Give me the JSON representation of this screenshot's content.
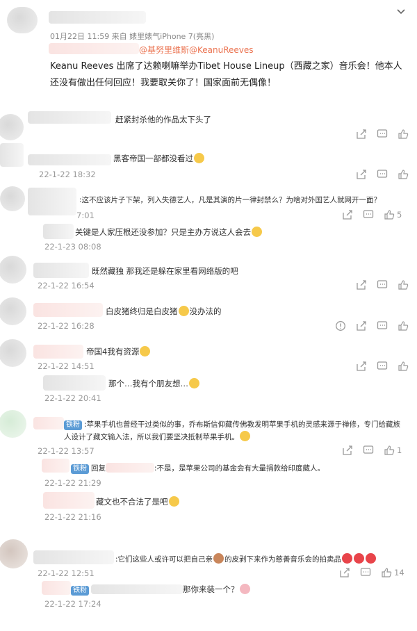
{
  "post": {
    "meta": "01月22日 11:59  来自 婊里婊气iPhone 7(亮黑)",
    "mentions": "@基努里维斯@KeanuReeves",
    "text": "Keanu Reeves 出席了达赖喇嘛举办Tibet House Lineup（西藏之家）音乐会！他本人还没有做出任何回应！我要取关你了！国家面前无偶像！"
  },
  "comments": [
    {
      "text": "赶紧封杀他的作品太下头了",
      "time": ""
    },
    {
      "text": "黑客帝国一部都没看过",
      "time": "22-1-22 18:32"
    },
    {
      "text": ":这不应该片子下架，列入失德艺人，凡是其演的片一律封禁么？为啥对外国艺人就网开一面？",
      "time": "7:01",
      "likes": "5"
    },
    {
      "text": "关键是人家压根还没参加？只是主办方说这人会去",
      "time": "22-1-23 08:08"
    },
    {
      "text": "既然藏独 那我还是躲在家里看网络版的吧",
      "time": "22-1-22 16:54"
    },
    {
      "text": "白皮猪终归是白皮猪",
      "text2": "没办法的",
      "time": "22-1-22 16:28"
    },
    {
      "text": "帝国4我有资源",
      "time": "22-1-22 14:51"
    },
    {
      "text": "那个…我有个朋友想…",
      "time": "22-1-22 20:41"
    },
    {
      "tag": "铁粉",
      "text": ":苹果手机也曾经干过类似的事，乔布斯信仰藏传佛教发明苹果手机的灵感来源于禅修，专门给藏族人设计了藏文输入法，所以我们要坚决抵制苹果手机。",
      "time": "22-1-22 13:57",
      "likes": "1"
    },
    {
      "tag": "铁粉",
      "prefix": "回复",
      "text": ":不是，是苹果公司的基金会有大量捐款给印度藏人。",
      "time": "22-1-22 21:29"
    },
    {
      "text": "藏文也不合法了是吧",
      "time": "22-1-22 21:16"
    },
    {
      "text": ":它们这些人或许可以把自己亲",
      "text2": "的皮剥下来作为慈善音乐会的拍卖品",
      "time": "22-1-22 12:51",
      "likes": "14"
    },
    {
      "tag": "铁粉",
      "text": "那你来装一个？",
      "time": "22-1-22 17:24"
    }
  ],
  "icons": {
    "share": "share-icon",
    "comment": "comment-icon",
    "like": "like-icon",
    "report": "report-icon",
    "expand": "chevron-down-icon"
  }
}
